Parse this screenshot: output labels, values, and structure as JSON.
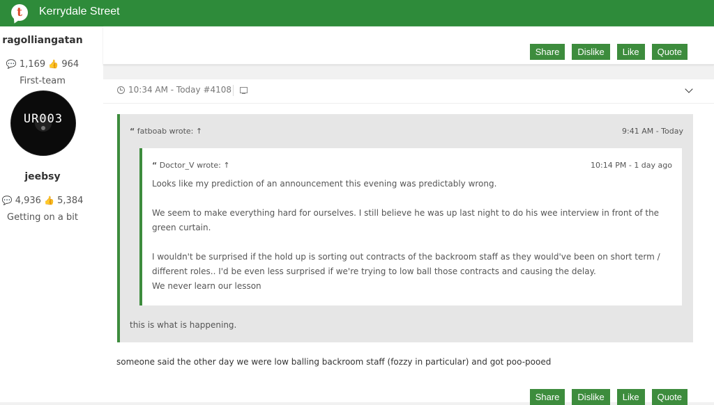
{
  "header": {
    "logo_glyph": "t",
    "title": "Kerrydale Street"
  },
  "users": [
    {
      "name": "ragolliangatan",
      "posts": "1,169",
      "likes": "964",
      "rank": "First-team"
    },
    {
      "name": "jeebsy",
      "posts": "4,936",
      "likes": "5,384",
      "rank": "Getting on a bit",
      "avatar_text": "UR003"
    }
  ],
  "actions": {
    "share": "Share",
    "dislike": "Dislike",
    "like": "Like",
    "quote": "Quote"
  },
  "post": {
    "meta": "10:34 AM - Today #4108",
    "outer_quote": {
      "author_line": "fatboab wrote: ↑",
      "time": "9:41 AM - Today",
      "inner_quote": {
        "author_line": "Doctor_V wrote: ↑",
        "time": "10:14 PM - 1 day ago",
        "paragraphs": [
          "Looks like my prediction of an announcement this evening was predictably wrong.",
          "We seem to make everything hard for ourselves. I still believe he was up last night to do his wee interview in front of the green curtain.",
          "I wouldn't be surprised if the hold up is sorting out contracts of the backroom staff as they would've been on short term / different roles.. I'd be even less surprised if we're trying to low ball those contracts and causing the delay.\nWe never learn our lesson"
        ]
      },
      "reply": "this is what is happening."
    },
    "body": "someone said the other day we were low balling backroom staff (fozzy in particular) and got poo-pooed"
  }
}
